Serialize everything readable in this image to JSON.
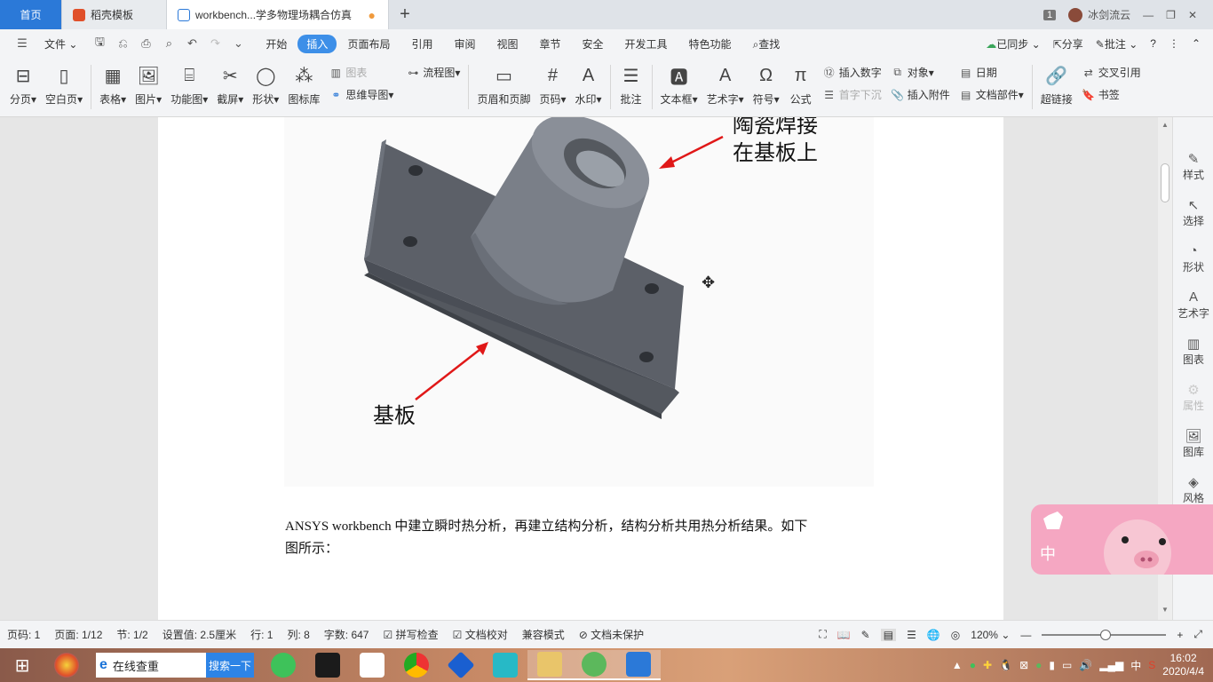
{
  "tabs": {
    "home": "首页",
    "template": "稻壳模板",
    "doc": "workbench...学多物理场耦合仿真"
  },
  "user": {
    "badge": "1",
    "name": "冰剑流云"
  },
  "menu": {
    "file": "文件",
    "items": [
      "开始",
      "插入",
      "页面布局",
      "引用",
      "审阅",
      "视图",
      "章节",
      "安全",
      "开发工具",
      "特色功能"
    ],
    "search": "查找",
    "sync": "已同步",
    "share": "分享",
    "comment": "批注"
  },
  "ribbon": {
    "page_break": "分页",
    "blank_page": "空白页",
    "table": "表格",
    "picture": "图片",
    "func_chart": "功能图",
    "screenshot": "截屏",
    "shape": "形状",
    "icon_lib": "图标库",
    "chart": "图表",
    "mindmap": "思维导图",
    "flowchart": "流程图",
    "header_footer": "页眉和页脚",
    "page_num": "页码",
    "watermark": "水印",
    "annotate": "批注",
    "textbox": "文本框",
    "wordart": "艺术字",
    "symbol": "符号",
    "formula": "公式",
    "insert_number": "插入数字",
    "drop_cap": "首字下沉",
    "object": "对象",
    "attachment": "插入附件",
    "date": "日期",
    "doc_part": "文档部件",
    "hyperlink": "超链接",
    "crossref": "交叉引用",
    "bookmark": "书签"
  },
  "figure": {
    "label_top_1": "陶瓷焊接",
    "label_top_2": "在基板上",
    "label_bottom": "基板"
  },
  "document": {
    "paragraph_1": "ANSYS workbench  中建立瞬时热分析，再建立结构分析，结构分析共用热分析结果。如下",
    "paragraph_2": "图所示："
  },
  "sidebar": [
    "样式",
    "选择",
    "形状",
    "艺术字",
    "图表",
    "属性",
    "图库",
    "风格"
  ],
  "pig_widget": {
    "char": "中"
  },
  "status": {
    "page_num": "页码: 1",
    "page": "页面: 1/12",
    "section": "节: 1/2",
    "setting": "设置值: 2.5厘米",
    "row": "行: 1",
    "col": "列: 8",
    "words": "字数: 647",
    "spell": "拼写检查",
    "proof": "文档校对",
    "compat": "兼容模式",
    "protect": "文档未保护",
    "zoom": "120%"
  },
  "taskbar": {
    "search_text": "在线查重",
    "search_btn": "搜索一下",
    "ime": "中",
    "time": "16:02",
    "date": "2020/4/4"
  },
  "colors": {
    "accent": "#3d8fe8",
    "home_tab": "#2b79d8",
    "arrow": "#e01818"
  }
}
